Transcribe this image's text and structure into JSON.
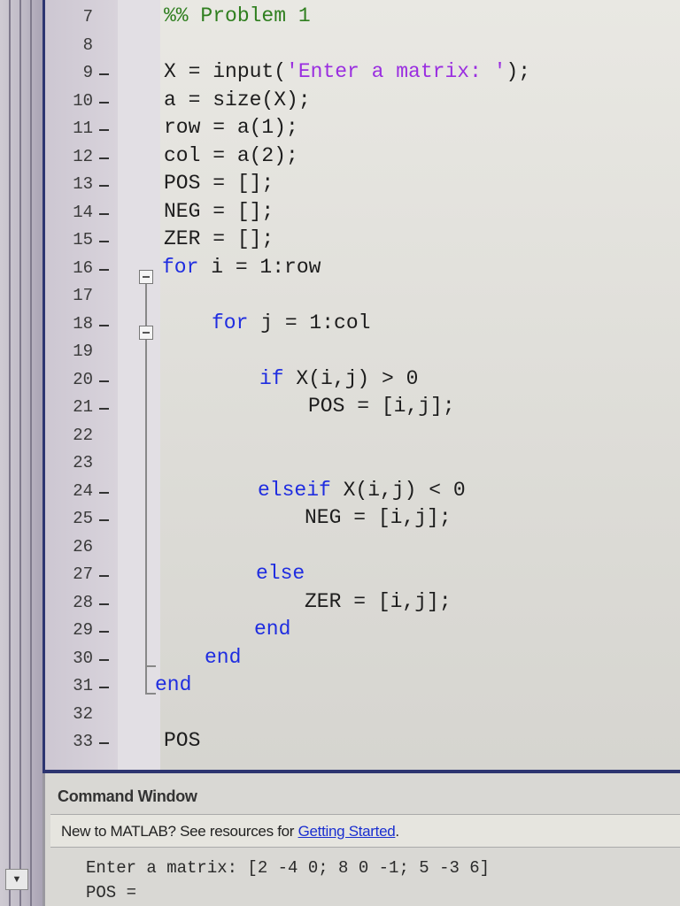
{
  "editor": {
    "lines": [
      {
        "num": "7",
        "dash": false,
        "segments": [
          {
            "text": "%% Problem 1",
            "type": "cm"
          }
        ]
      },
      {
        "num": "8",
        "dash": false,
        "segments": []
      },
      {
        "num": "9",
        "dash": true,
        "segments": [
          {
            "text": "X = input(",
            "type": "plain"
          },
          {
            "text": "'Enter a matrix: '",
            "type": "str"
          },
          {
            "text": ");",
            "type": "plain"
          }
        ]
      },
      {
        "num": "10",
        "dash": true,
        "segments": [
          {
            "text": "a = size(X);",
            "type": "plain"
          }
        ]
      },
      {
        "num": "11",
        "dash": true,
        "segments": [
          {
            "text": "row = a(1);",
            "type": "plain"
          }
        ]
      },
      {
        "num": "12",
        "dash": true,
        "segments": [
          {
            "text": "col = a(2);",
            "type": "plain"
          }
        ]
      },
      {
        "num": "13",
        "dash": true,
        "segments": [
          {
            "text": "POS = [];",
            "type": "plain"
          }
        ]
      },
      {
        "num": "14",
        "dash": true,
        "segments": [
          {
            "text": "NEG = [];",
            "type": "plain"
          }
        ]
      },
      {
        "num": "15",
        "dash": true,
        "segments": [
          {
            "text": "ZER = [];",
            "type": "plain"
          }
        ]
      },
      {
        "num": "16",
        "dash": true,
        "segments": [
          {
            "text": "for",
            "type": "kw"
          },
          {
            "text": " i = 1:row",
            "type": "plain"
          }
        ]
      },
      {
        "num": "17",
        "dash": false,
        "segments": []
      },
      {
        "num": "18",
        "dash": true,
        "segments": [
          {
            "text": "for",
            "type": "kw"
          },
          {
            "text": " j = 1:col",
            "type": "plain"
          }
        ]
      },
      {
        "num": "19",
        "dash": false,
        "segments": []
      },
      {
        "num": "20",
        "dash": true,
        "segments": [
          {
            "text": "if",
            "type": "kw"
          },
          {
            "text": " X(i,j) > 0",
            "type": "plain"
          }
        ]
      },
      {
        "num": "21",
        "dash": true,
        "segments": [
          {
            "text": "POS = [i,j];",
            "type": "plain"
          }
        ]
      },
      {
        "num": "22",
        "dash": false,
        "segments": []
      },
      {
        "num": "23",
        "dash": false,
        "segments": []
      },
      {
        "num": "24",
        "dash": true,
        "segments": [
          {
            "text": "elseif",
            "type": "kw"
          },
          {
            "text": " X(i,j) < 0",
            "type": "plain"
          }
        ]
      },
      {
        "num": "25",
        "dash": true,
        "segments": [
          {
            "text": "NEG = [i,j];",
            "type": "plain"
          }
        ]
      },
      {
        "num": "26",
        "dash": false,
        "segments": []
      },
      {
        "num": "27",
        "dash": true,
        "segments": [
          {
            "text": "else",
            "type": "kw"
          }
        ]
      },
      {
        "num": "28",
        "dash": true,
        "segments": [
          {
            "text": "ZER = [i,j];",
            "type": "plain"
          }
        ]
      },
      {
        "num": "29",
        "dash": true,
        "segments": [
          {
            "text": "end",
            "type": "kw"
          }
        ]
      },
      {
        "num": "30",
        "dash": true,
        "segments": [
          {
            "text": "end",
            "type": "kw"
          }
        ]
      },
      {
        "num": "31",
        "dash": true,
        "segments": [
          {
            "text": "end",
            "type": "kw"
          }
        ]
      },
      {
        "num": "32",
        "dash": false,
        "segments": []
      },
      {
        "num": "33",
        "dash": true,
        "segments": [
          {
            "text": "POS",
            "type": "plain"
          }
        ]
      }
    ]
  },
  "command_window": {
    "title": "Command Window",
    "banner_text": "New to MATLAB? See resources for ",
    "banner_link": "Getting Started",
    "banner_end": ".",
    "console_lines": [
      "Enter a matrix: [2 -4 0; 8 0 -1; 5 -3 6]",
      "POS ="
    ]
  },
  "icons": {
    "scroll_down": "▼"
  }
}
